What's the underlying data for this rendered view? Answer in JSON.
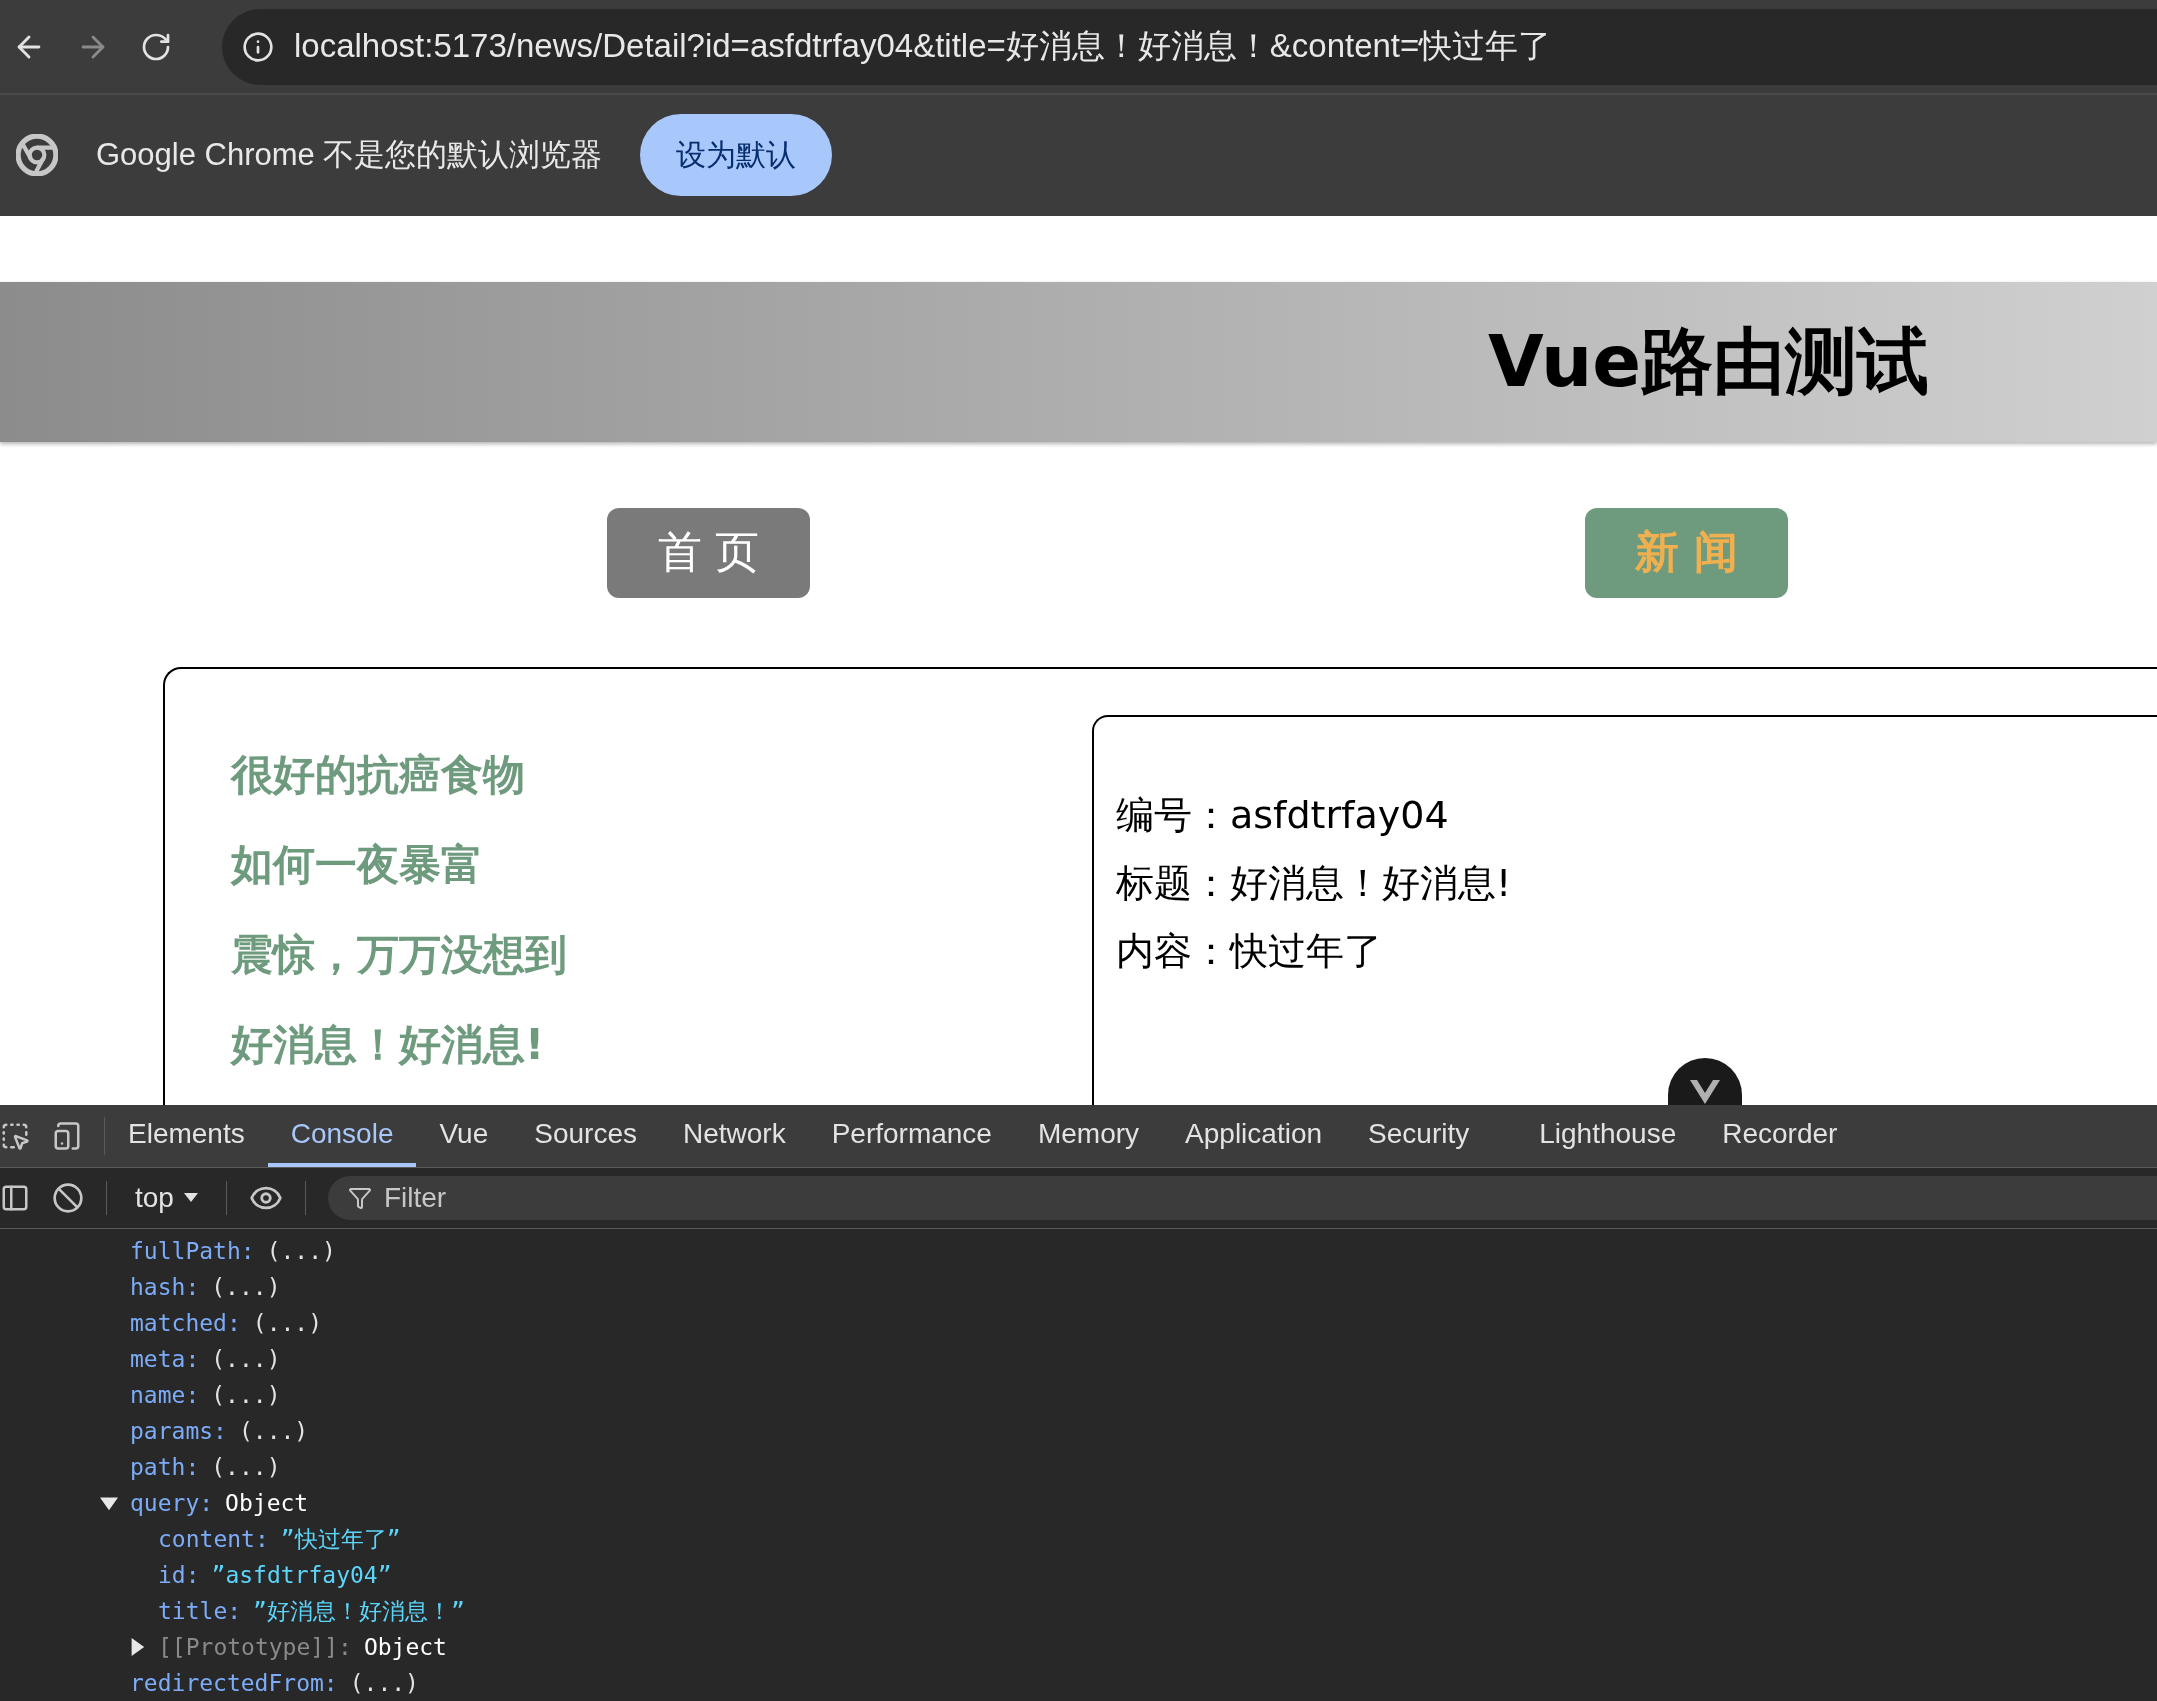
{
  "browser": {
    "url": "localhost:5173/news/Detail?id=asfdtrfay04&title=好消息！好消息！&content=快过年了",
    "forward_disabled": true,
    "infobar": {
      "message": "Google Chrome 不是您的默认浏览器",
      "button": "设为默认"
    }
  },
  "page": {
    "title": "Vue路由测试",
    "nav": [
      {
        "label": "首 页",
        "selected": false
      },
      {
        "label": "新 闻",
        "selected": true
      }
    ],
    "news": [
      "很好的抗癌食物",
      "如何一夜暴富",
      "震惊，万万没想到",
      "好消息！好消息!"
    ],
    "detail": [
      "编号：asfdtrfay04",
      "标题：好消息！好消息!",
      "内容：快过年了"
    ]
  },
  "devtools": {
    "tabs": [
      {
        "label": "Elements",
        "selected": false
      },
      {
        "label": "Console",
        "selected": true
      },
      {
        "label": "Vue",
        "selected": false
      },
      {
        "label": "Sources",
        "selected": false
      },
      {
        "label": "Network",
        "selected": false
      },
      {
        "label": "Performance",
        "selected": false
      },
      {
        "label": "Memory",
        "selected": false
      },
      {
        "label": "Application",
        "selected": false
      },
      {
        "label": "Security",
        "selected": false
      },
      {
        "label": "Lighthouse",
        "selected": false
      },
      {
        "label": "Recorder",
        "selected": false
      }
    ],
    "context": "top",
    "filter_placeholder": "Filter",
    "console": [
      {
        "key": "fullPath:",
        "value": "(...)",
        "kind": "getter"
      },
      {
        "key": "hash:",
        "value": "(...)",
        "kind": "getter"
      },
      {
        "key": "matched:",
        "value": "(...)",
        "kind": "getter"
      },
      {
        "key": "meta:",
        "value": "(...)",
        "kind": "getter"
      },
      {
        "key": "name:",
        "value": "(...)",
        "kind": "getter"
      },
      {
        "key": "params:",
        "value": "(...)",
        "kind": "getter"
      },
      {
        "key": "path:",
        "value": "(...)",
        "kind": "getter"
      },
      {
        "key": "query:",
        "value": "Object",
        "kind": "object",
        "expanded": true,
        "children": [
          {
            "key": "content:",
            "value": "”快过年了”",
            "kind": "string"
          },
          {
            "key": "id:",
            "value": "”asfdtrfay04”",
            "kind": "string"
          },
          {
            "key": "title:",
            "value": "”好消息！好消息！”",
            "kind": "string"
          },
          {
            "key": "[[Prototype]]:",
            "value": "Object",
            "kind": "internal",
            "expanded": false
          }
        ]
      },
      {
        "key": "redirectedFrom:",
        "value": "(...)",
        "kind": "getter"
      }
    ]
  }
}
